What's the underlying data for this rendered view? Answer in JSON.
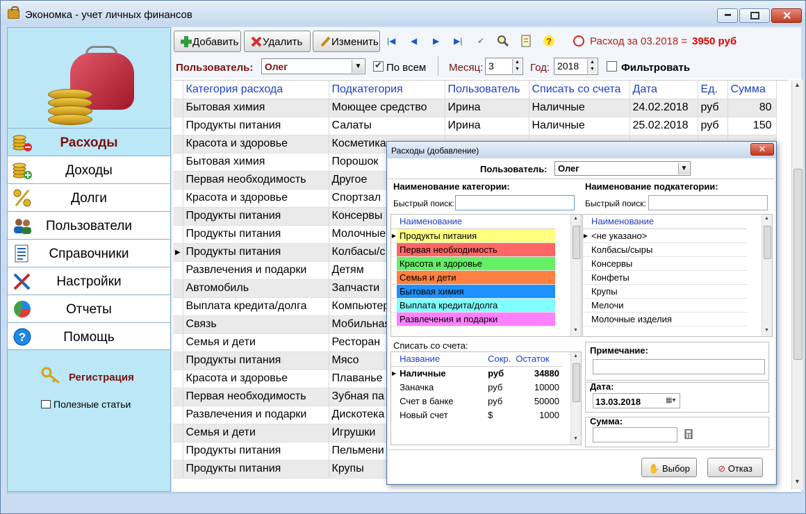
{
  "window": {
    "title": "Экономка - учет личных финансов"
  },
  "sidebar": {
    "items": [
      {
        "label": "Расходы",
        "icon": "coins-minus-icon",
        "active": true
      },
      {
        "label": "Доходы",
        "icon": "coins-plus-icon",
        "active": false
      },
      {
        "label": "Долги",
        "icon": "percent-icon",
        "active": false
      },
      {
        "label": "Пользователи",
        "icon": "users-icon",
        "active": false
      },
      {
        "label": "Справочники",
        "icon": "reference-list-icon",
        "active": false
      },
      {
        "label": "Настройки",
        "icon": "tools-icon",
        "active": false
      },
      {
        "label": "Отчеты",
        "icon": "pie-chart-icon",
        "active": false
      },
      {
        "label": "Помощь",
        "icon": "help-icon",
        "active": false
      }
    ],
    "register_label": "Регистрация",
    "articles_label": "Полезные статьи"
  },
  "toolbar": {
    "add_label": "Добавить",
    "delete_label": "Удалить",
    "edit_label": "Изменить",
    "status_text": "Расход за 03.2018 =",
    "status_amount": "3950 руб"
  },
  "filter": {
    "user_label": "Пользователь:",
    "user_value": "Олег",
    "all_label": "По всем",
    "all_checked": true,
    "month_label": "Месяц:",
    "month_value": "3",
    "year_label": "Год:",
    "year_value": "2018",
    "filter_label": "Фильтровать",
    "filter_checked": false
  },
  "grid": {
    "columns": [
      "Категория расхода",
      "Подкатегория",
      "Пользователь",
      "Списать со счета",
      "Дата",
      "Ед.",
      "Сумма"
    ],
    "rows": [
      [
        "Бытовая химия",
        "Моющее средство",
        "Ирина",
        "Наличные",
        "24.02.2018",
        "руб",
        "80"
      ],
      [
        "Продукты питания",
        "Салаты",
        "Ирина",
        "Наличные",
        "25.02.2018",
        "руб",
        "150"
      ],
      [
        "Красота и здоровье",
        "Косметика",
        "",
        "",
        "",
        "",
        ""
      ],
      [
        "Бытовая химия",
        "Порошок",
        "",
        "",
        "",
        "",
        ""
      ],
      [
        "Первая необходимость",
        "Другое",
        "",
        "",
        "",
        "",
        ""
      ],
      [
        "Красота и здоровье",
        "Спортзал",
        "",
        "",
        "",
        "",
        ""
      ],
      [
        "Продукты питания",
        "Консервы",
        "",
        "",
        "",
        "",
        ""
      ],
      [
        "Продукты питания",
        "Молочные",
        "",
        "",
        "",
        "",
        ""
      ],
      [
        "Продукты питания",
        "Колбасы/с",
        "",
        "",
        "",
        "",
        ""
      ],
      [
        "Развлечения и подарки",
        "Детям",
        "",
        "",
        "",
        "",
        ""
      ],
      [
        "Автомобиль",
        "Запчасти",
        "",
        "",
        "",
        "",
        ""
      ],
      [
        "Выплата кредита/долга",
        "Компьютер",
        "",
        "",
        "",
        "",
        ""
      ],
      [
        "Связь",
        "Мобильная",
        "",
        "",
        "",
        "",
        ""
      ],
      [
        "Семья и дети",
        "Ресторан",
        "",
        "",
        "",
        "",
        ""
      ],
      [
        "Продукты питания",
        "Мясо",
        "",
        "",
        "",
        "",
        ""
      ],
      [
        "Красота и здоровье",
        "Плаванье",
        "",
        "",
        "",
        "",
        ""
      ],
      [
        "Первая необходимость",
        "Зубная па",
        "",
        "",
        "",
        "",
        ""
      ],
      [
        "Развлечения и подарки",
        "Дискотека",
        "",
        "",
        "",
        "",
        ""
      ],
      [
        "Семья и дети",
        "Игрушки",
        "",
        "",
        "",
        "",
        ""
      ],
      [
        "Продукты питания",
        "Пельмени",
        "",
        "",
        "",
        "",
        ""
      ],
      [
        "Продукты питания",
        "Крупы",
        "",
        "",
        "",
        "",
        ""
      ]
    ],
    "current_row": 8
  },
  "dialog": {
    "title": "Расходы (добавление)",
    "user_label": "Пользователь:",
    "user_value": "Олег",
    "cat_header": "Наименование категории:",
    "subcat_header": "Наименование подкатегории:",
    "quick_search_label": "Быстрый поиск:",
    "cat_search_value": "",
    "subcat_search_value": "",
    "name_col": "Наименование",
    "categories": [
      {
        "name": "Продукты питания",
        "color": "#ffff80"
      },
      {
        "name": "Первая необходимость",
        "color": "#ff6666"
      },
      {
        "name": "Красота и здоровье",
        "color": "#66ee66"
      },
      {
        "name": "Семья и дети",
        "color": "#ff8040"
      },
      {
        "name": "Бытовая химия",
        "color": "#1e90ff"
      },
      {
        "name": "Выплата кредита/долга",
        "color": "#80ffff"
      },
      {
        "name": "Развлечения и подарки",
        "color": "#ff80ff"
      }
    ],
    "subcategories": [
      "<не указано>",
      "Колбасы/сыры",
      "Консервы",
      "Конфеты",
      "Крупы",
      "Мелочи",
      "Молочные изделия"
    ],
    "account_label": "Списать со счета:",
    "account_cols": [
      "Название",
      "Сокр.",
      "Остаток"
    ],
    "accounts": [
      [
        "Наличные",
        "руб",
        "34880"
      ],
      [
        "Заначка",
        "руб",
        "10000"
      ],
      [
        "Счет в банке",
        "руб",
        "50000"
      ],
      [
        "Новый счет",
        "$",
        "1000"
      ]
    ],
    "note_label": "Примечание:",
    "note_value": "",
    "date_label": "Дата:",
    "date_value": "13.03.2018",
    "sum_label": "Сумма:",
    "sum_value": "",
    "ok_label": "Выбор",
    "cancel_label": "Отказ"
  }
}
